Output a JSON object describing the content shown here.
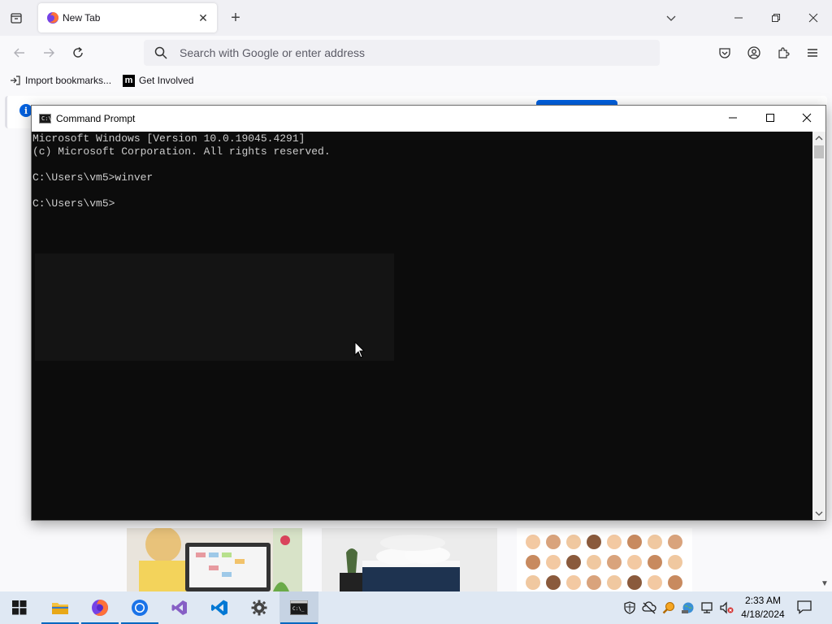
{
  "browser": {
    "tab": {
      "title": "New Tab"
    },
    "urlbar": {
      "placeholder": "Search with Google or enter address"
    },
    "bookmarks": [
      {
        "label": "Import bookmarks..."
      },
      {
        "label": "Get Involved"
      }
    ],
    "accent_color": "#0061e0"
  },
  "cmd": {
    "title": "Command Prompt",
    "lines": [
      "Microsoft Windows [Version 10.0.19045.4291]",
      "(c) Microsoft Corporation. All rights reserved.",
      "",
      "C:\\Users\\vm5>winver",
      "",
      "C:\\Users\\vm5>"
    ]
  },
  "taskbar": {
    "apps": [
      {
        "name": "start",
        "icon": "windows-logo-icon"
      },
      {
        "name": "file-explorer",
        "icon": "folder-icon"
      },
      {
        "name": "firefox",
        "icon": "firefox-icon"
      },
      {
        "name": "chrome",
        "icon": "chrome-icon"
      },
      {
        "name": "visual-studio",
        "icon": "visual-studio-icon"
      },
      {
        "name": "vscode",
        "icon": "vscode-icon"
      },
      {
        "name": "settings",
        "icon": "gear-icon"
      },
      {
        "name": "command-prompt",
        "icon": "terminal-icon"
      }
    ],
    "clock": {
      "time": "2:33 AM",
      "date": "4/18/2024"
    },
    "accent_color": "#0067c0"
  }
}
